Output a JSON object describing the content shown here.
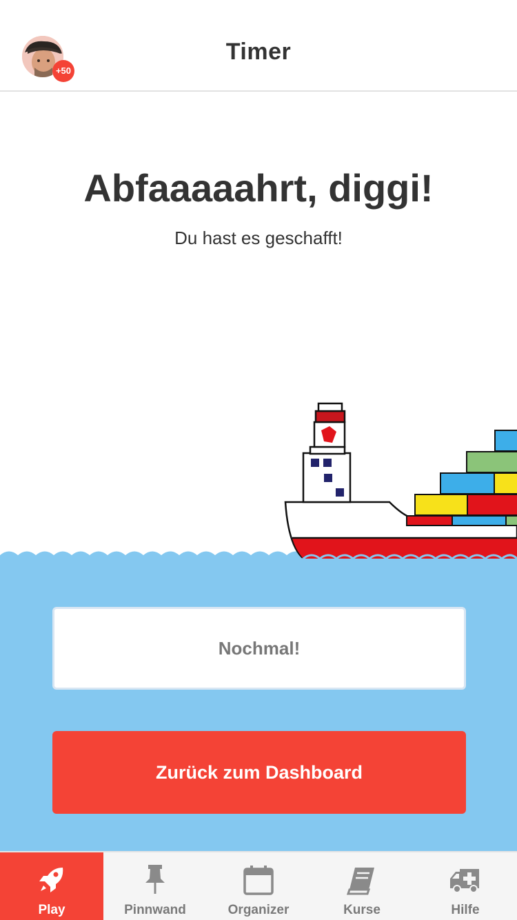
{
  "header": {
    "title": "Timer",
    "badge": "+50"
  },
  "main": {
    "headline": "Abfaaaaahrt, diggi!",
    "subline": "Du hast es geschafft!"
  },
  "actions": {
    "again_label": "Nochmal!",
    "dashboard_label": "Zurück zum Dashboard"
  },
  "tabs": [
    {
      "label": "Play",
      "icon": "rocket-icon",
      "active": true
    },
    {
      "label": "Pinnwand",
      "icon": "pin-icon",
      "active": false
    },
    {
      "label": "Organizer",
      "icon": "calendar-icon",
      "active": false
    },
    {
      "label": "Kurse",
      "icon": "book-icon",
      "active": false
    },
    {
      "label": "Hilfe",
      "icon": "ambulance-icon",
      "active": false
    }
  ],
  "colors": {
    "accent": "#f44336",
    "water": "#84c8f0",
    "tab_bg": "#f5f5f5",
    "text": "#333333"
  }
}
